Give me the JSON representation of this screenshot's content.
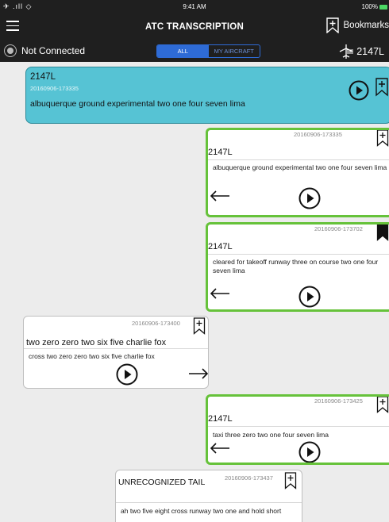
{
  "status_bar": {
    "signal": "✈ .ıll ◇",
    "time": "9:41 AM",
    "battery": "100%"
  },
  "header": {
    "title": "ATC TRANSCRIPTION",
    "bookmarks_label": "Bookmarks",
    "connection_status": "Not Connected",
    "tabs": [
      "ALL",
      "MY AIRCRAFT"
    ],
    "selected_tab": "ALL",
    "aircraft_tail": "2147L"
  },
  "highlight": {
    "tail": "2147L",
    "timestamp": "20160906-173335",
    "text": "albuquerque ground experimental two one four seven lima"
  },
  "messages": [
    {
      "tail": "2147L",
      "timestamp": "20160906-173335",
      "text": "albuquerque ground experimental two one four seven lima",
      "bookmarked": false
    },
    {
      "tail": "2147L",
      "timestamp": "20160906-173702",
      "text": "cleared for takeoff runway three on course two one four seven lima",
      "bookmarked": true
    },
    {
      "tail": "two zero zero two six five charlie fox",
      "timestamp": "20160906-173400",
      "text": "cross two zero zero two six five charlie fox",
      "bookmarked": false
    },
    {
      "tail": "2147L",
      "timestamp": "20160906-173425",
      "text": "taxi three zero two one four seven lima",
      "bookmarked": false
    },
    {
      "tail": "UNRECOGNIZED TAIL",
      "timestamp": "20160906-173437",
      "text": "ah two five eight cross runway two one and hold short",
      "bookmarked": false
    }
  ],
  "colors": {
    "accent_blue": "#2e6bd6",
    "highlight_cyan": "#56c3d4",
    "own_border_green": "#66c23a",
    "battery_green": "#4cd964"
  }
}
